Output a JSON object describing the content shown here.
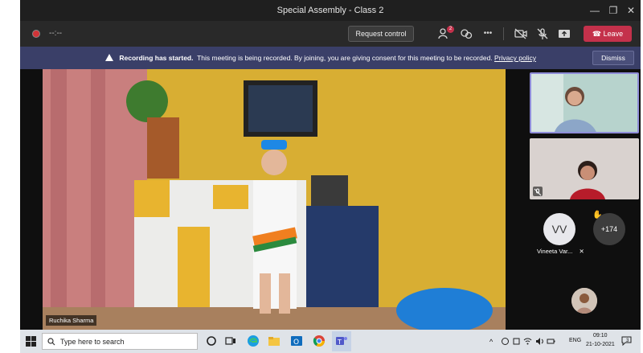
{
  "window": {
    "title": "Special Assembly - Class 2",
    "minimize": "—",
    "maximize": "❐",
    "close": "✕"
  },
  "toolbar": {
    "timer": "--:--",
    "request_control": "Request control",
    "participants_badge": "2",
    "more": "•••",
    "leave": "Leave"
  },
  "banner": {
    "bold": "Recording has started.",
    "message": "This meeting is being recorded. By joining, you are giving consent for this meeting to be recorded.",
    "link": "Privacy policy",
    "dismiss": "Dismiss"
  },
  "stage": {
    "main_speaker_name": "Ruchika Sharma",
    "avatar_initials": "VV",
    "avatar_name": "Vineeta Var...",
    "more_count": "+174"
  },
  "taskbar": {
    "search_placeholder": "Type here to search",
    "language": "ENG",
    "time": "09:10",
    "date": "21-10-2021",
    "notification_count": "3"
  },
  "colors": {
    "leave": "#c4314b",
    "banner": "#3a3f68",
    "active_speaker_border": "#8e8cd8",
    "recording_dot": "#d13438"
  }
}
